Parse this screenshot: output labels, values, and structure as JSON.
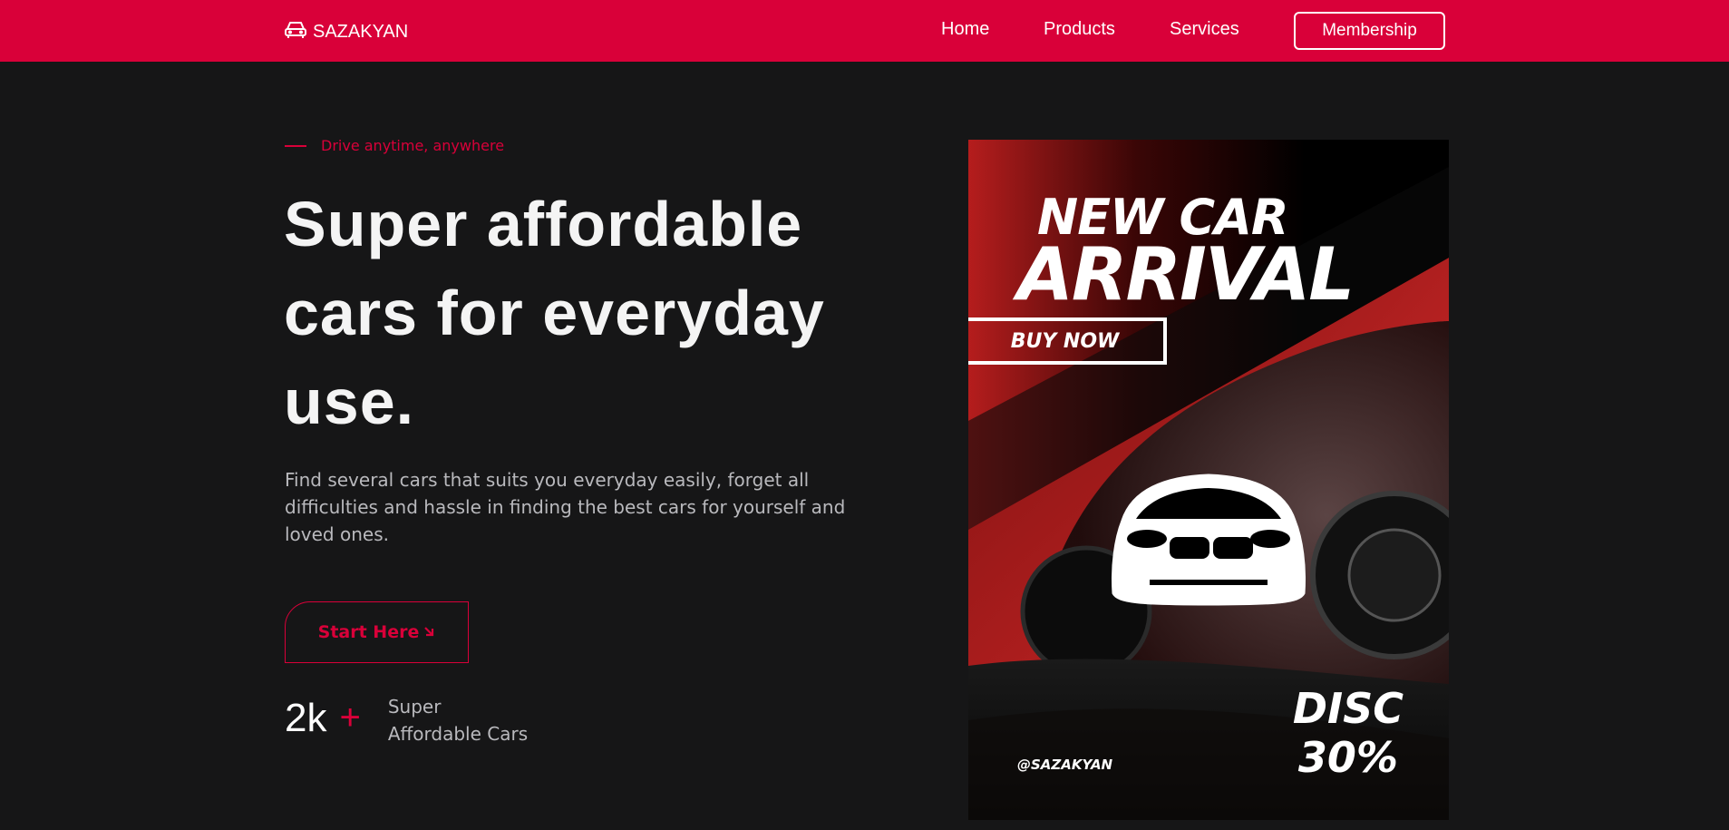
{
  "brand": {
    "name": "SAZAKYAN",
    "icon": "car-icon"
  },
  "nav": {
    "items": [
      "Home",
      "Products",
      "Services"
    ],
    "membership_label": "Membership"
  },
  "hero": {
    "tagline": "Drive anytime, anywhere",
    "headline_line1": "Super affordable",
    "headline_line2": "cars for everyday",
    "headline_line3": "use.",
    "description": "Find several cars that suits you everyday easily, forget all difficulties and hassle in finding the best cars for yourself and loved ones.",
    "cta_label": "Start Here",
    "cta_icon": "arrow-down-right-icon",
    "stat_value": "2k",
    "stat_plus": "+",
    "stat_label_line1": "Super",
    "stat_label_line2": "Affordable Cars"
  },
  "poster": {
    "title_line1": "NEW CAR",
    "title_line2": "ARRIVAL",
    "buy_label": "BUY NOW",
    "disc_line1": "DISC",
    "disc_line2": "30%",
    "handle": "@SAZAKYAN"
  },
  "colors": {
    "accent": "#d90039",
    "background": "#161617",
    "text_muted": "#b9b9bd"
  }
}
